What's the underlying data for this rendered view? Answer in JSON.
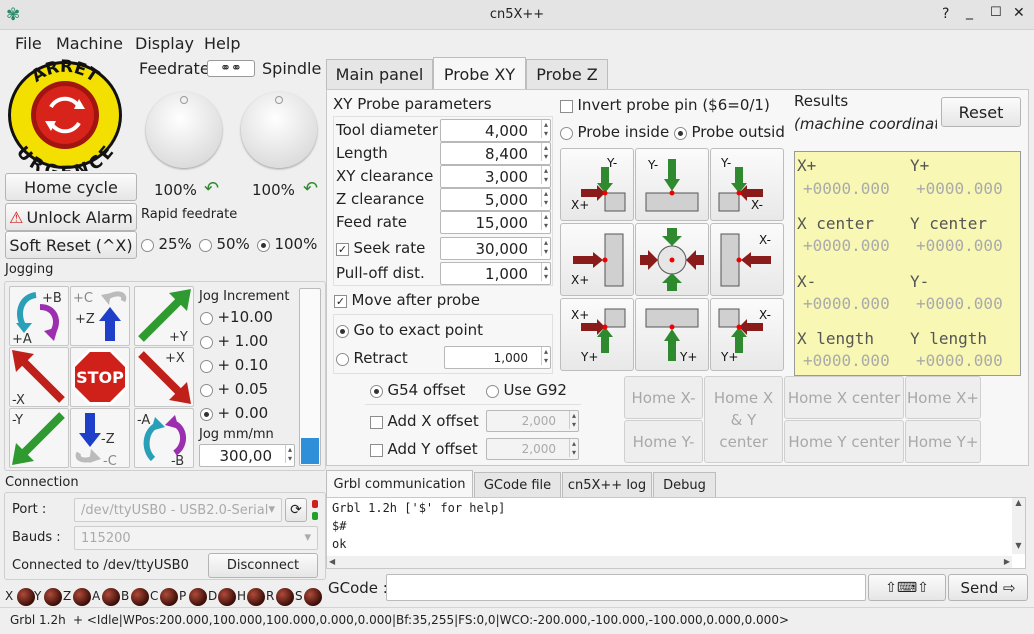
{
  "window": {
    "title": "cn5X++"
  },
  "menu": [
    "File",
    "Machine",
    "Display",
    "Help"
  ],
  "estop": {
    "line1": "ARRET",
    "line2": "URGENCE"
  },
  "overrides": {
    "feed_label": "Feedrate",
    "spindle_label": "Spindle",
    "feed_value": "100%",
    "spindle_value": "100%"
  },
  "buttons": {
    "home": "Home cycle",
    "unlock": "Unlock Alarm",
    "reset": "Soft Reset (^X)"
  },
  "rapid": {
    "label": "Rapid feedrate",
    "options": [
      "25%",
      "50%",
      "100%"
    ],
    "selected": "100%"
  },
  "jogging": {
    "title": "Jogging",
    "increment_label": "Jog Increment",
    "increments": [
      "+10.00",
      "+ 1.00",
      "+ 0.10",
      "+ 0.05",
      "+ 0.00"
    ],
    "selected": "+ 0.00",
    "speed_label": "Jog mm/mn",
    "speed": "300,00",
    "keys": [
      "+B",
      "+A",
      "+C",
      "+Z",
      "+Y",
      "-X",
      "STOP",
      "+X",
      "-Y",
      "-Z",
      "-C",
      "-A",
      "-B"
    ]
  },
  "connection": {
    "title": "Connection",
    "port_label": "Port :",
    "port": "/dev/ttyUSB0 - USB2.0-Serial",
    "bauds_label": "Bauds :",
    "bauds": "115200",
    "status": "Connected to /dev/ttyUSB0",
    "disconnect": "Disconnect"
  },
  "leds": [
    "X",
    "Y",
    "Z",
    "A",
    "B",
    "C",
    "P",
    "D",
    "H",
    "R",
    "S"
  ],
  "tabs": [
    "Main panel",
    "Probe XY",
    "Probe Z"
  ],
  "probe": {
    "params_title": "XY Probe parameters",
    "params": [
      {
        "label": "Tool diameter",
        "value": "4,000"
      },
      {
        "label": "Length",
        "value": "8,400"
      },
      {
        "label": "XY clearance",
        "value": "3,000"
      },
      {
        "label": "Z clearance",
        "value": "5,000"
      },
      {
        "label": "Feed rate",
        "value": "15,000"
      },
      {
        "label": "Seek rate",
        "value": "30,000"
      },
      {
        "label": "Pull-off dist.",
        "value": "1,000"
      }
    ],
    "move_after": "Move after probe",
    "goto_exact": "Go to exact point",
    "retract": "Retract",
    "retract_value": "1,000",
    "g54": "G54 offset",
    "g92": "Use G92",
    "add_x": "Add X offset",
    "add_x_value": "2,000",
    "add_y": "Add Y offset",
    "add_y_value": "2,000",
    "invert_pin": "Invert probe pin ($6=0/1)",
    "inside": "Probe inside",
    "outside": "Probe outsid",
    "results_title": "Results",
    "results_sub": "(machine coordinate",
    "reset": "Reset",
    "results": [
      {
        "l": "X+",
        "r": "Y+",
        "lv": "+0000.000",
        "rv": "+0000.000"
      },
      {
        "l": "X center",
        "r": "Y center",
        "lv": "+0000.000",
        "rv": "+0000.000"
      },
      {
        "l": "X-",
        "r": "Y-",
        "lv": "+0000.000",
        "rv": "+0000.000"
      },
      {
        "l": "X length",
        "r": "Y length",
        "lv": "+0000.000",
        "rv": "+0000.000"
      }
    ],
    "home_buttons": [
      "Home X-",
      "Home X & Y center",
      "Home Y center",
      "Home X center",
      "Home X+",
      "Home Y-",
      "Home Y+"
    ]
  },
  "bottom_tabs": [
    "Grbl communication",
    "GCode file",
    "cn5X++ log",
    "Debug"
  ],
  "console": [
    "Grbl 1.2h ['$' for help]",
    "$#",
    "ok"
  ],
  "gcode": {
    "label": "GCode :",
    "send": "Send ⇨",
    "kbd": "⇧⌨⇧"
  },
  "status_bar": {
    "version": "Grbl 1.2h",
    "status": "+ <Idle|WPos:200.000,100.000,100.000,0.000,0.000|Bf:35,255|FS:0,0|WCO:-200.000,-100.000,-100.000,0.000,0.000>"
  },
  "colors": {
    "results_bg": "#f8f8b4",
    "arrow_green": "#2f9a2f",
    "arrow_red": "#8a1b1b",
    "estop_red": "#d8231a",
    "estop_yellow": "#f4e000"
  }
}
